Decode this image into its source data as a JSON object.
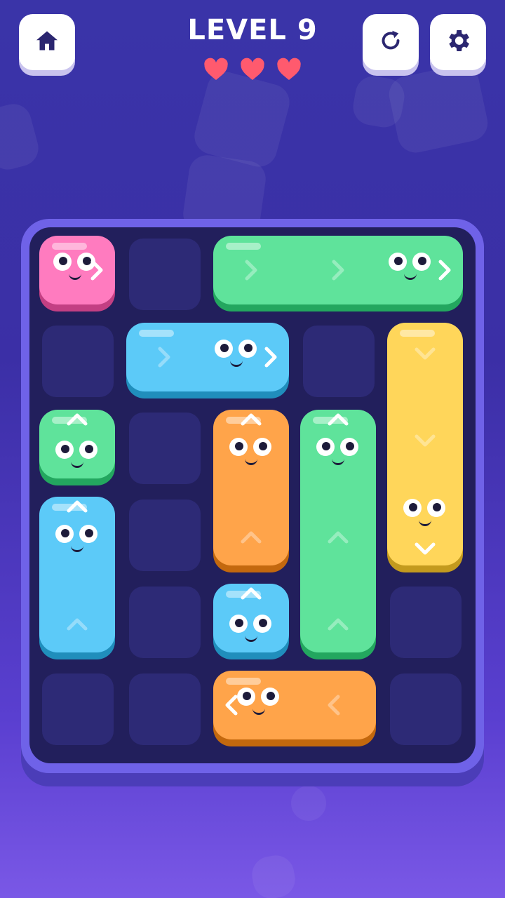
{
  "header": {
    "level_title": "LEVEL 9",
    "home_icon": "home-icon",
    "restart_icon": "restart-icon",
    "settings_icon": "gear-icon",
    "lives": 3
  },
  "colors": {
    "pink": "#ff7bbf",
    "green": "#5fe39b",
    "blue": "#5ccaf8",
    "orange": "#ffa44a",
    "yellow": "#ffd65a",
    "heart": "#ff5a6e"
  },
  "board": {
    "columns": 5,
    "rows": 6,
    "pieces": [
      {
        "id": "pink-1",
        "color": "pink",
        "col": 0,
        "row": 0,
        "w": 1,
        "h": 1,
        "direction": "right"
      },
      {
        "id": "green-h",
        "color": "green",
        "col": 2,
        "row": 0,
        "w": 3,
        "h": 1,
        "direction": "right"
      },
      {
        "id": "blue-h",
        "color": "blue",
        "col": 1,
        "row": 1,
        "w": 2,
        "h": 1,
        "direction": "right"
      },
      {
        "id": "yellow-v",
        "color": "yellow",
        "col": 4,
        "row": 1,
        "w": 1,
        "h": 3,
        "direction": "down"
      },
      {
        "id": "green-small",
        "color": "green",
        "col": 0,
        "row": 2,
        "w": 1,
        "h": 1,
        "direction": "up"
      },
      {
        "id": "orange-v",
        "color": "orange",
        "col": 2,
        "row": 2,
        "w": 1,
        "h": 2,
        "direction": "up"
      },
      {
        "id": "green-v",
        "color": "green",
        "col": 3,
        "row": 2,
        "w": 1,
        "h": 3,
        "direction": "up"
      },
      {
        "id": "blue-v",
        "color": "blue",
        "col": 0,
        "row": 3,
        "w": 1,
        "h": 2,
        "direction": "up"
      },
      {
        "id": "blue-small",
        "color": "blue",
        "col": 2,
        "row": 4,
        "w": 1,
        "h": 1,
        "direction": "up"
      },
      {
        "id": "orange-h",
        "color": "orange",
        "col": 2,
        "row": 5,
        "w": 2,
        "h": 1,
        "direction": "left"
      }
    ]
  }
}
